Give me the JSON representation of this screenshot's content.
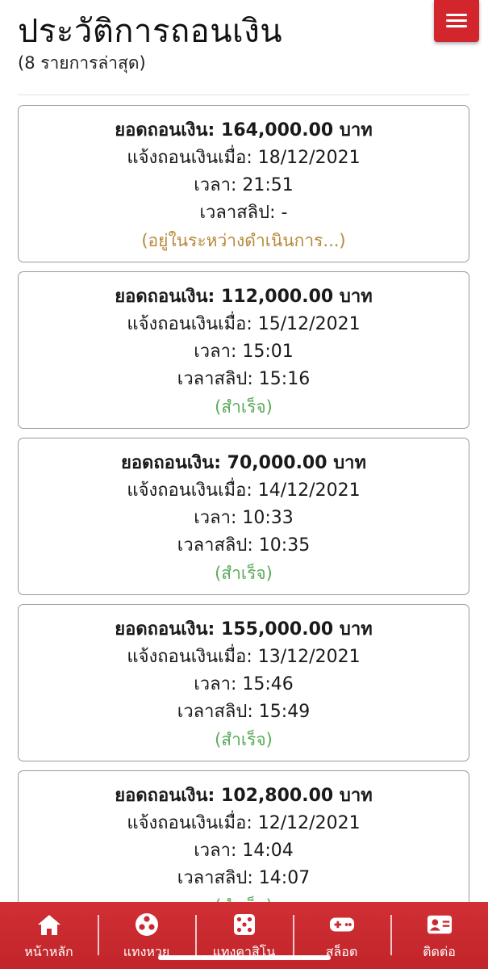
{
  "header": {
    "title": "ประวัติการถอนเงิน",
    "subtitle": "(8 รายการล่าสุด)"
  },
  "labels": {
    "amount": "ยอดถอนเงิน:",
    "currency": "บาท",
    "requested": "แจ้งถอนเงินเมื่อ:",
    "time": "เวลา:",
    "slip_time": "เวลาสลิป:"
  },
  "withdrawals": [
    {
      "amount": "164,000.00",
      "date": "18/12/2021",
      "time": "21:51",
      "slip_time": "-",
      "status": "(อยู่ในระหว่างดำเนินการ...)",
      "status_color": "#b8893a"
    },
    {
      "amount": "112,000.00",
      "date": "15/12/2021",
      "time": "15:01",
      "slip_time": "15:16",
      "status": "(สำเร็จ)",
      "status_color": "#5aab5a"
    },
    {
      "amount": "70,000.00",
      "date": "14/12/2021",
      "time": "10:33",
      "slip_time": "10:35",
      "status": "(สำเร็จ)",
      "status_color": "#5aab5a"
    },
    {
      "amount": "155,000.00",
      "date": "13/12/2021",
      "time": "15:46",
      "slip_time": "15:49",
      "status": "(สำเร็จ)",
      "status_color": "#5aab5a"
    },
    {
      "amount": "102,800.00",
      "date": "12/12/2021",
      "time": "14:04",
      "slip_time": "14:07",
      "status": "(สำเร็จ)",
      "status_color": "#5aab5a"
    }
  ],
  "nav": [
    {
      "label": "หน้าหลัก",
      "icon": "home-icon"
    },
    {
      "label": "แทงหวย",
      "icon": "lottery-ball-icon"
    },
    {
      "label": "แทงคาสิโน",
      "icon": "dice-icon"
    },
    {
      "label": "สล็อต",
      "icon": "gamepad-icon"
    },
    {
      "label": "ติดต่อ",
      "icon": "contact-card-icon"
    }
  ],
  "colors": {
    "brand_red": "#d3262c",
    "pending": "#b8893a",
    "success": "#5aab5a"
  }
}
